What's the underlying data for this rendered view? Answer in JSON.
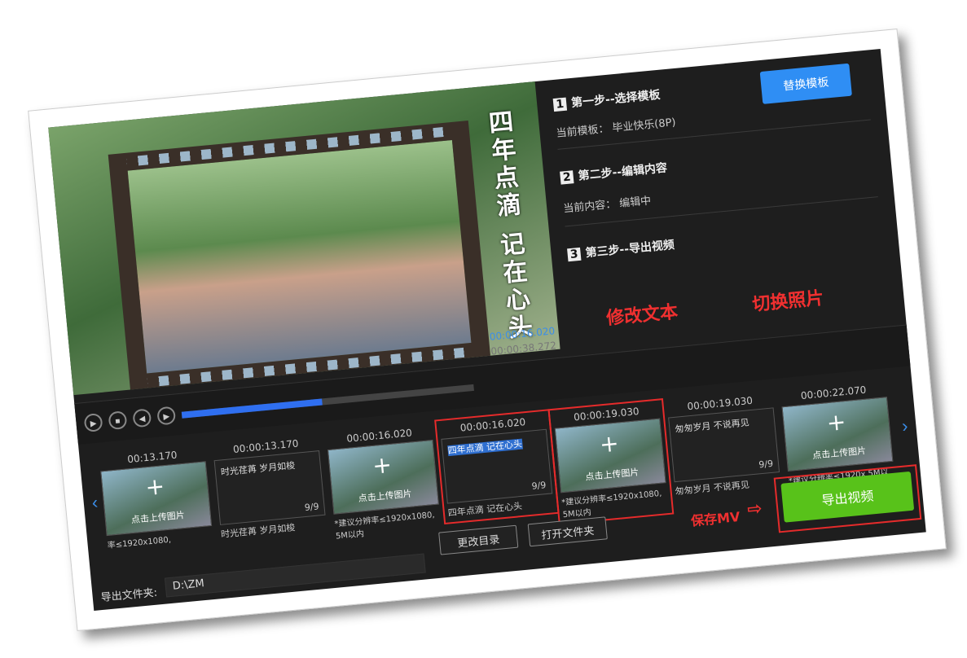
{
  "preview": {
    "overlay_text": "四年点滴 记在心头",
    "current_time": "00:00:16.020",
    "total_time": "00:00:38.272"
  },
  "steps": [
    {
      "num": "1",
      "title": "第一步--选择模板",
      "label": "当前模板：",
      "value": "毕业快乐(8P)",
      "button": "替换模板"
    },
    {
      "num": "2",
      "title": "第二步--编辑内容",
      "label": "当前内容：",
      "value": "编辑中"
    },
    {
      "num": "3",
      "title": "第三步--导出视频"
    }
  ],
  "annotations": {
    "edit_text": "修改文本",
    "switch_photo": "切换照片",
    "save_mv": "保存MV"
  },
  "playback": {
    "progress_percent": 48,
    "buttons": [
      "play",
      "stop",
      "prev",
      "next"
    ]
  },
  "clips": [
    {
      "time": "00:13.170",
      "type": "photo",
      "upload": "点击上传图片",
      "note": "率≤1920x1080,"
    },
    {
      "time": "00:00:13.170",
      "type": "text",
      "text": "时光荏苒 岁月如梭",
      "count": "9/9",
      "caption": "时光荏苒 岁月如梭"
    },
    {
      "time": "00:00:16.020",
      "type": "photo",
      "upload": "点击上传图片",
      "note": "*建议分辨率≤1920x1080, 5M以内"
    },
    {
      "time": "00:00:16.020",
      "type": "text",
      "text": "四年点滴 记在心头",
      "count": "9/9",
      "caption": "四年点滴 记在心头",
      "selected": true
    },
    {
      "time": "00:00:19.030",
      "type": "photo",
      "upload": "点击上传图片",
      "note": "*建议分辨率≤1920x1080, 5M以内"
    },
    {
      "time": "00:00:19.030",
      "type": "text",
      "text": "匆匆岁月 不说再见",
      "count": "9/9",
      "caption": "匆匆岁月 不说再见"
    },
    {
      "time": "00:00:22.070",
      "type": "photo",
      "upload": "点击上传图片",
      "note": "*建议分辨率≤1920x 5M以内"
    }
  ],
  "bottom": {
    "folder_label": "导出文件夹:",
    "folder_value": "D:\\ZM",
    "change_dir": "更改目录",
    "open_folder": "打开文件夹",
    "export": "导出视频"
  },
  "colors": {
    "accent": "#2f8ef4",
    "export": "#58c21a",
    "annotation": "#e52b2b"
  }
}
